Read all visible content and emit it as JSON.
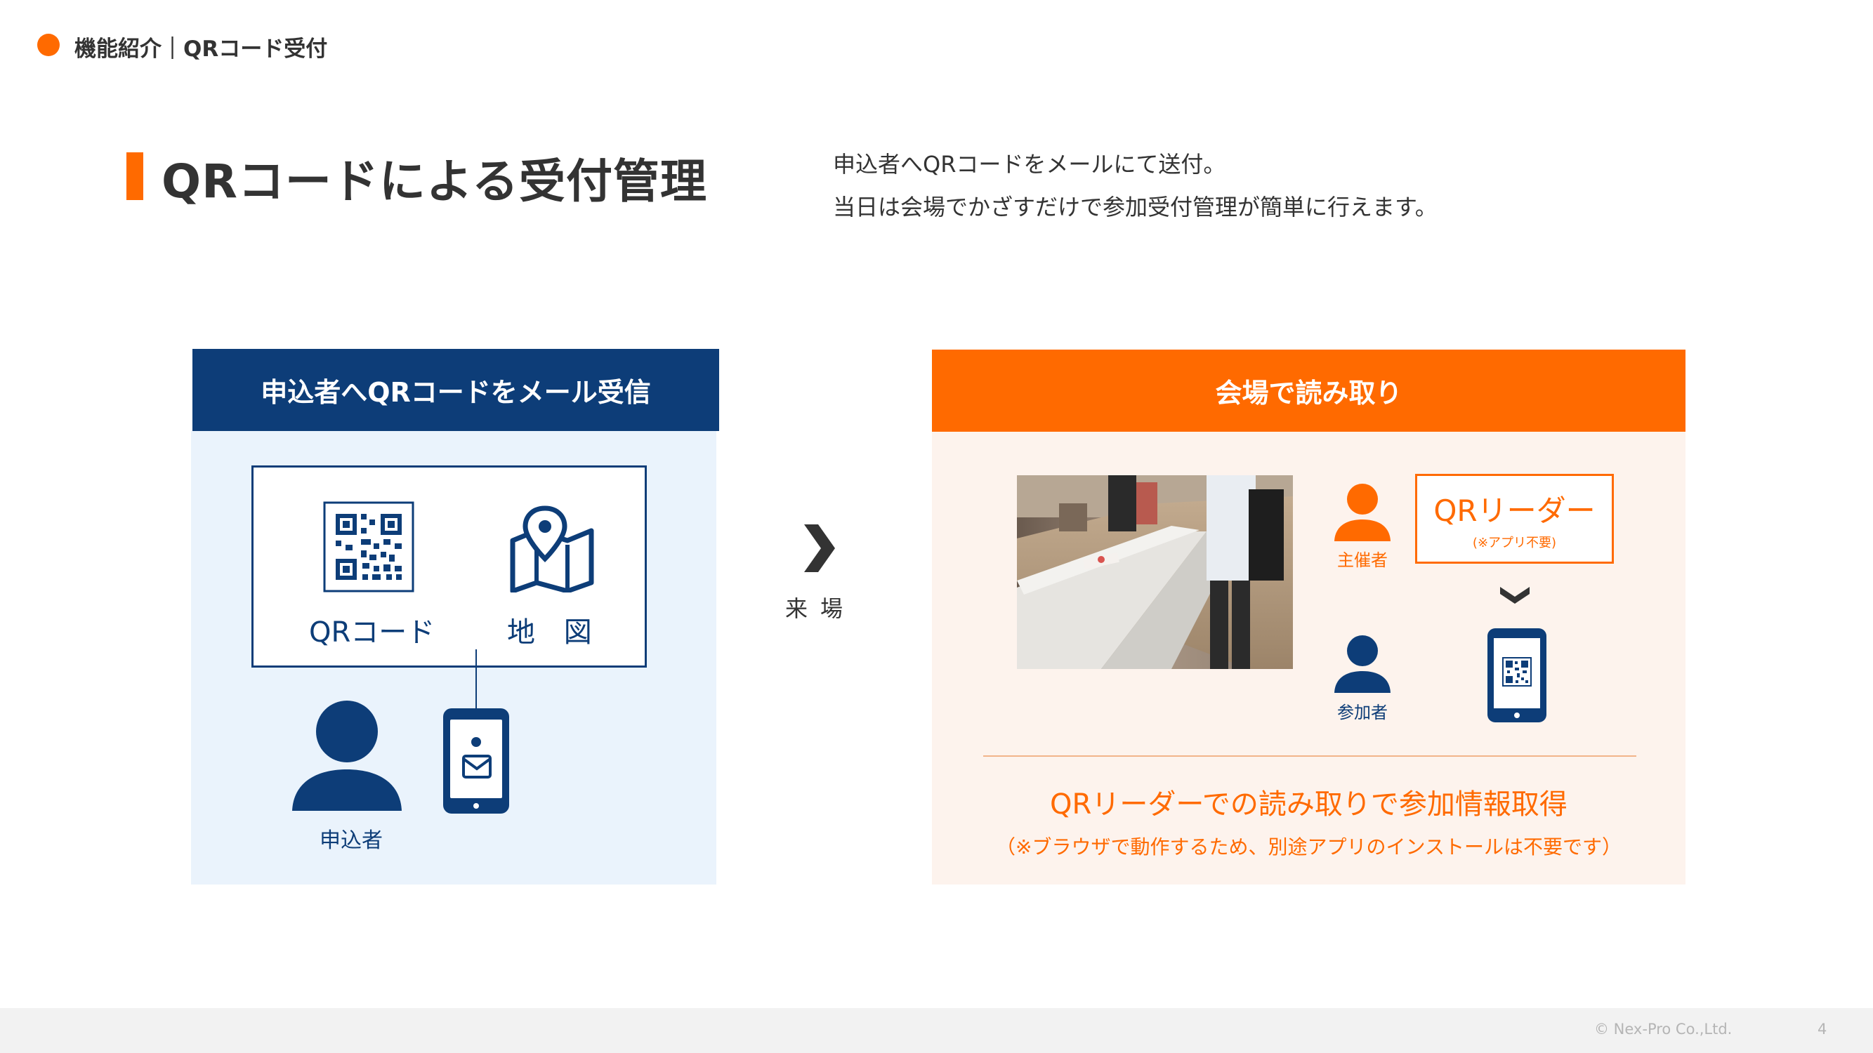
{
  "header": {
    "breadcrumb": "機能紹介｜QRコード受付"
  },
  "title": "QRコードによる受付管理",
  "description": {
    "line1": "申込者へQRコードをメールにて送付。",
    "line2": "当日は会場でかざすだけで参加受付管理が簡単に行えます。"
  },
  "left_panel": {
    "heading": "申込者へQRコードをメール受信",
    "qr_label": "QRコード",
    "map_label": "地 図",
    "person_label": "申込者"
  },
  "arrow": {
    "label": "来場"
  },
  "right_panel": {
    "heading": "会場で読み取り",
    "organizer_label": "主催者",
    "participant_label": "参加者",
    "reader_title": "QRリーダー",
    "reader_note": "(※アプリ不要)",
    "main_text": "QRリーダーでの読み取りで参加情報取得",
    "sub_text": "（※ブラウザで動作するため、別途アプリのインストールは不要です）"
  },
  "footer": {
    "copyright": "© Nex-Pro Co.,Ltd.",
    "page_number": "4"
  },
  "colors": {
    "accent_orange": "#ff6a00",
    "navy": "#0d3d78",
    "light_blue_bg": "#eaf3fc",
    "light_orange_bg": "#fdf3ed"
  },
  "icons": [
    "qr-code-icon",
    "map-pin-icon",
    "person-icon",
    "mail-icon",
    "smartphone-icon",
    "chevron-right-icon",
    "chevron-down-icon"
  ]
}
